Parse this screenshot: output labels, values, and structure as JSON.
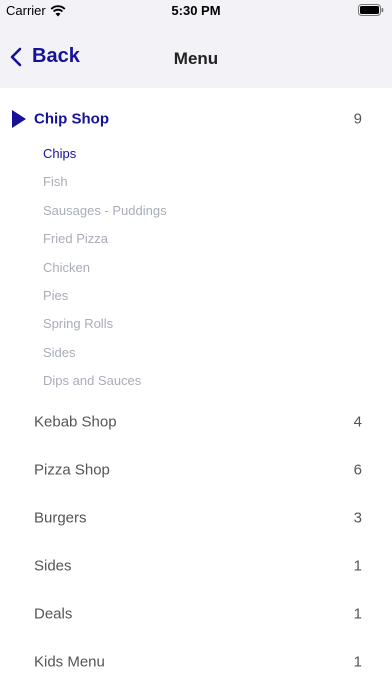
{
  "status_bar": {
    "carrier": "Carrier",
    "time": "5:30 PM"
  },
  "nav": {
    "back_label": "Back",
    "title": "Menu"
  },
  "colors": {
    "accent": "#15129a",
    "muted": "#a9adb8",
    "nav_bg": "#f2f2f7"
  },
  "active_category": {
    "label": "Chip Shop",
    "count": "9",
    "subitems": [
      {
        "label": "Chips",
        "selected": true
      },
      {
        "label": "Fish"
      },
      {
        "label": "Sausages - Puddings"
      },
      {
        "label": "Fried Pizza"
      },
      {
        "label": "Chicken"
      },
      {
        "label": "Pies"
      },
      {
        "label": "Spring Rolls"
      },
      {
        "label": "Sides"
      },
      {
        "label": "Dips and Sauces"
      }
    ]
  },
  "categories": [
    {
      "label": "Kebab Shop",
      "count": "4"
    },
    {
      "label": "Pizza Shop",
      "count": "6"
    },
    {
      "label": "Burgers",
      "count": "3"
    },
    {
      "label": "Sides",
      "count": "1"
    },
    {
      "label": "Deals",
      "count": "1"
    },
    {
      "label": "Kids Menu",
      "count": "1"
    }
  ]
}
